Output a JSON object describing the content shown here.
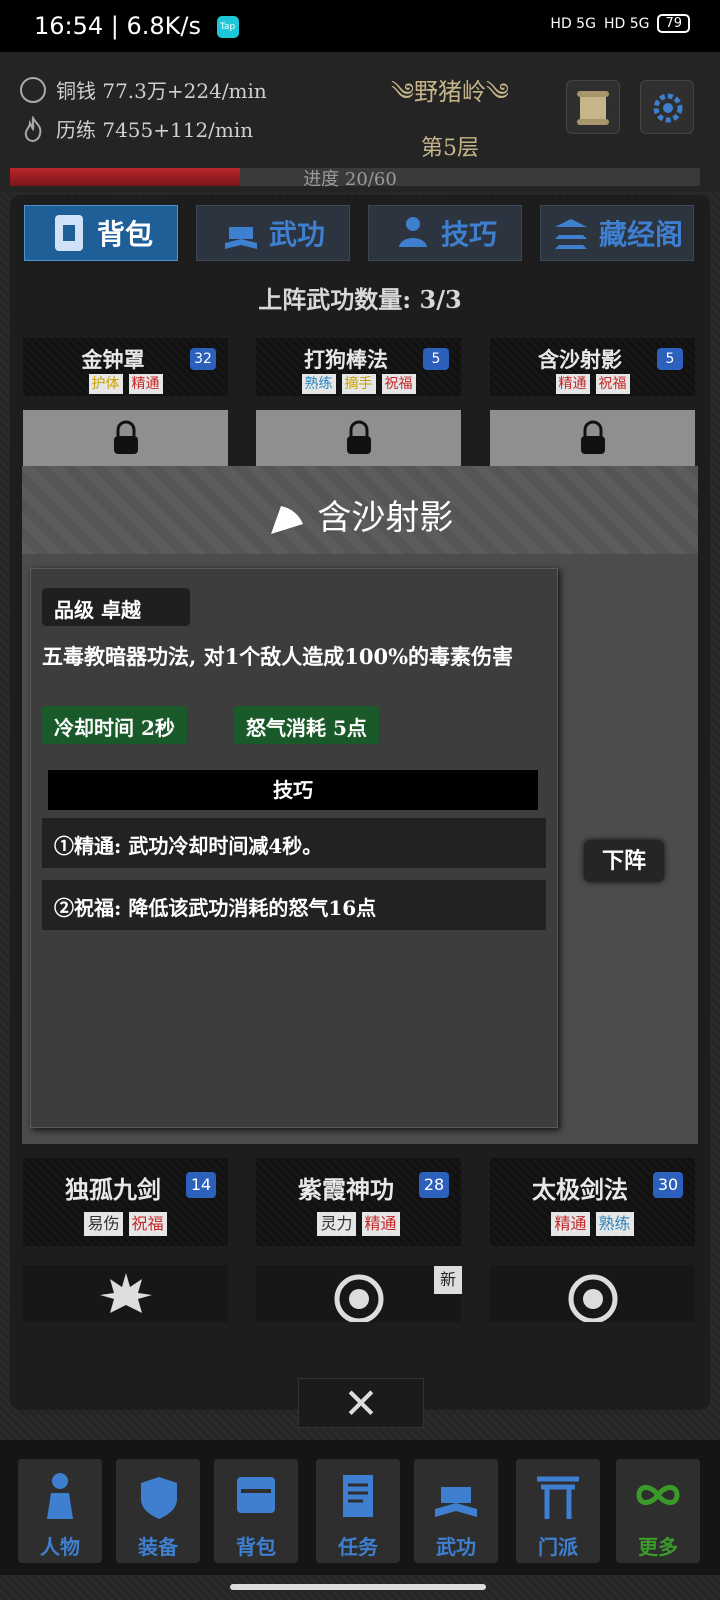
{
  "status_bar": {
    "time": "16:54",
    "speed": "6.8K/s",
    "tap_app": "Tap",
    "signal_1": "HD 5G",
    "signal_2": "HD 5G",
    "battery": "79"
  },
  "header": {
    "coins": "铜钱  77.3万+224/min",
    "experience": "历练  7455+112/min",
    "location": "༄野猪岭༄",
    "floor": "第5层",
    "progress_text": "进度  20/60",
    "progress_fraction": 0.333
  },
  "tabs": [
    {
      "label": "背包",
      "active": true
    },
    {
      "label": "武功",
      "active": false
    },
    {
      "label": "技巧",
      "active": false
    },
    {
      "label": "藏经阁",
      "active": false
    }
  ],
  "slot_count": "上阵武功数量: 3/3",
  "equipped": [
    {
      "name": "金钟罩",
      "level": "32",
      "tags": [
        "护体",
        "精通"
      ]
    },
    {
      "name": "打狗棒法",
      "level": "5",
      "tags": [
        "熟练",
        "摘手",
        "祝福"
      ]
    },
    {
      "name": "含沙射影",
      "level": "5",
      "tags": [
        "精通",
        "祝福"
      ]
    }
  ],
  "detail": {
    "title": "含沙射影",
    "grade": "品级   卓越",
    "description": "五毒教暗器功法, 对1个敌人造成100%的毒素伤害",
    "cooldown": "冷却时间  2秒",
    "rage_cost": "怒气消耗  5点",
    "perks_header": "技巧",
    "perks": [
      "①精通: 武功冷却时间减4秒。",
      "②祝福: 降低该武功消耗的怒气16点"
    ],
    "unequip_label": "下阵"
  },
  "inventory": [
    {
      "name": "独孤九剑",
      "level": "14",
      "tags": [
        "易伤",
        "祝福"
      ]
    },
    {
      "name": "紫霞神功",
      "level": "28",
      "tags": [
        "灵力",
        "精通"
      ]
    },
    {
      "name": "太极剑法",
      "level": "30",
      "tags": [
        "精通",
        "熟练"
      ]
    }
  ],
  "new_badge": "新",
  "close_label": "✕",
  "bottom_nav": [
    {
      "label": "人物",
      "icon": "character-icon"
    },
    {
      "label": "装备",
      "icon": "equipment-icon"
    },
    {
      "label": "背包",
      "icon": "backpack-icon"
    },
    {
      "label": "任务",
      "icon": "quest-icon"
    },
    {
      "label": "武功",
      "icon": "martial-arts-icon"
    },
    {
      "label": "门派",
      "icon": "sect-icon"
    },
    {
      "label": "更多",
      "icon": "infinity-icon"
    }
  ],
  "colors": {
    "accent_blue": "#3f7fd0",
    "active_tab": "#1e5f98",
    "stat_green": "#1a5a2a",
    "progress_red": "#b9252b",
    "more_green": "#3a9b2a"
  }
}
